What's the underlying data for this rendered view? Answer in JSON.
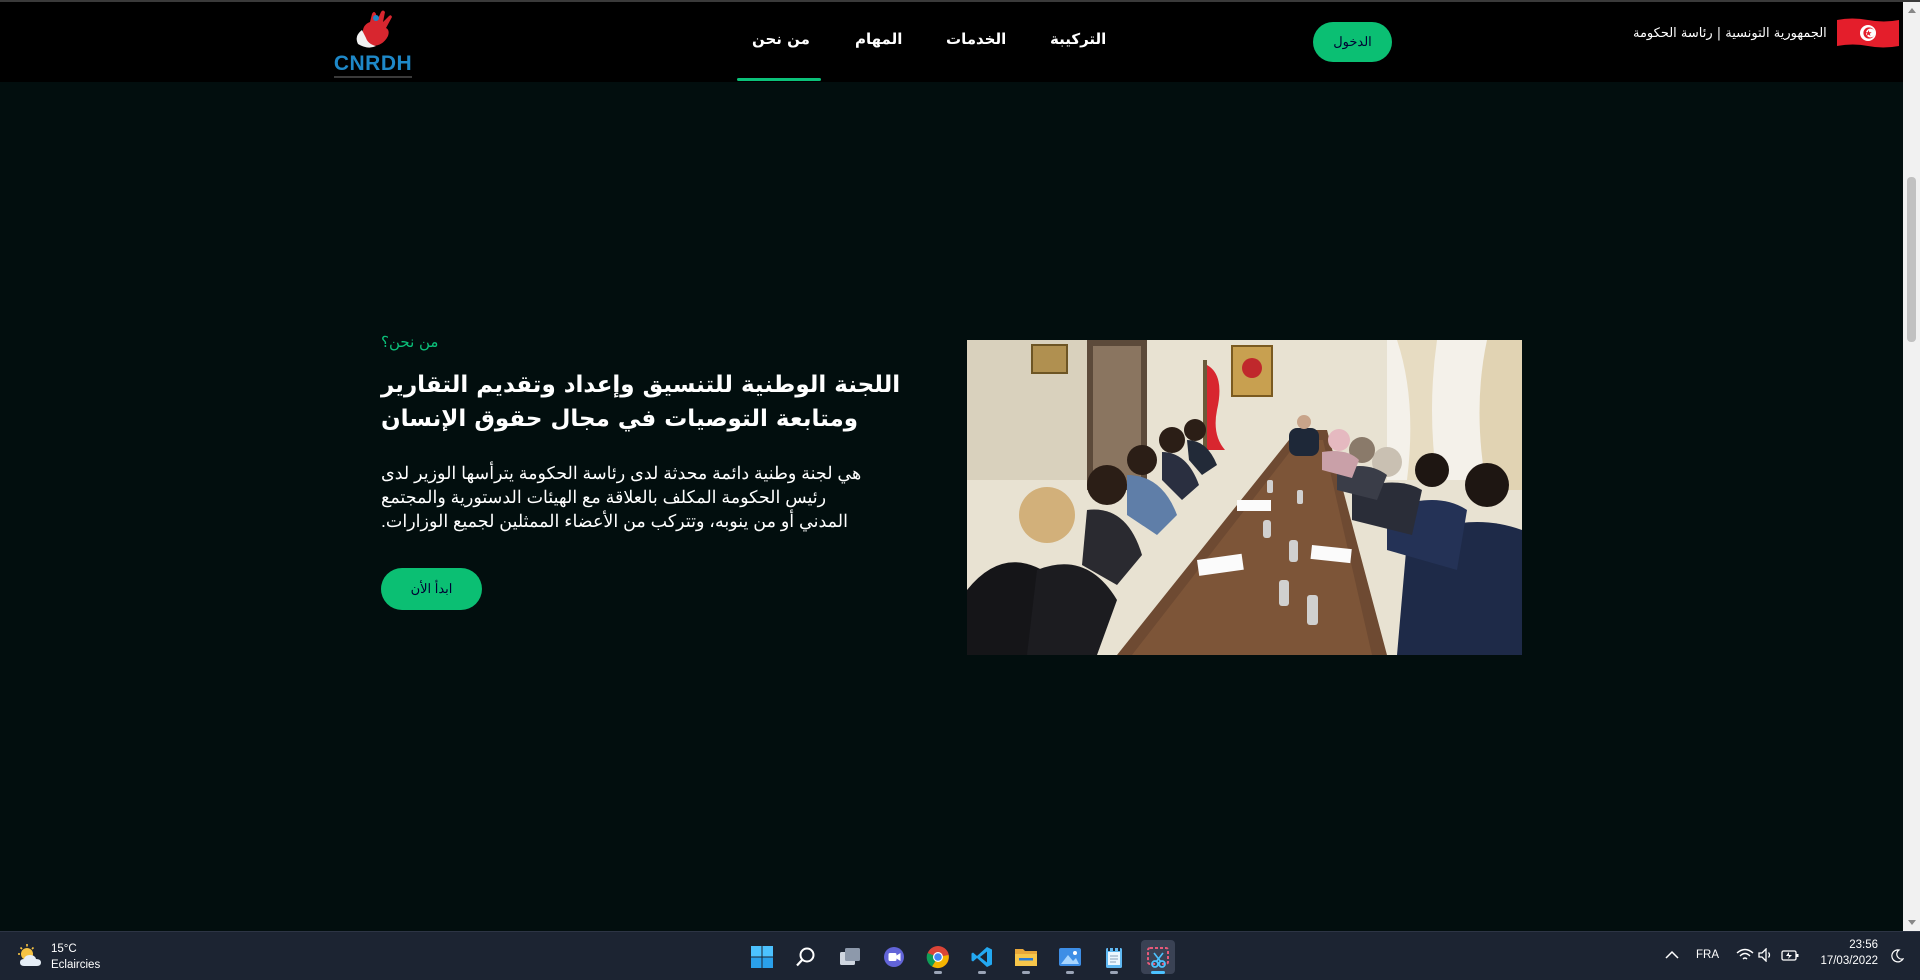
{
  "header": {
    "logo_text": "CNRDH",
    "nav": [
      {
        "label": "من نحن",
        "active": true
      },
      {
        "label": "المهام"
      },
      {
        "label": "الخدمات"
      },
      {
        "label": "التركيبة"
      }
    ],
    "login_label": "الدخول",
    "government_text": "الجمهورية التونسية | رئاسة الحكومة"
  },
  "about": {
    "subtitle": "من نحن؟",
    "headline": "اللجنة الوطنية للتنسيق وإعداد وتقديم التقارير ومتابعة التوصيات في مجال حقوق الإنسان",
    "description": "هي لجنة وطنية دائمة محدثة لدى رئاسة الحكومة يترأسها الوزير لدى رئيس الحكومة المكلف بالعلاقة مع الهيئات الدستورية والمجتمع المدني أو من ينوبه، وتتركب من الأعضاء الممثلين لجميع الوزارات.",
    "start_label": "ابدأ الأن"
  },
  "taskbar": {
    "weather_temp": "15°C",
    "weather_desc": "Eclaircies",
    "language": "FRA",
    "time": "23:56",
    "date": "17/03/2022"
  },
  "colors": {
    "accent": "#0bc17a",
    "page_bg": "#020e0e",
    "header_bg": "#000000",
    "taskbar_bg": "#1c2432"
  }
}
